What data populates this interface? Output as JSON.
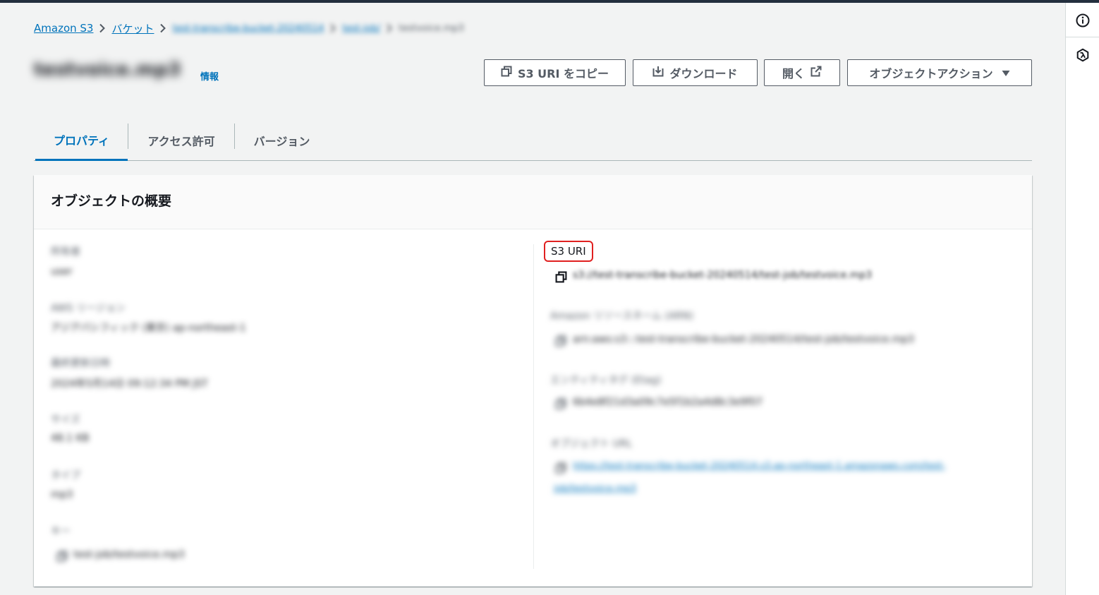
{
  "breadcrumb": {
    "items": [
      "Amazon S3",
      "バケット",
      "test-transcribe-bucket-20240514",
      "test-job/",
      "testvoice.mp3"
    ]
  },
  "header": {
    "object_name": "testvoice.mp3",
    "info_label": "情報"
  },
  "actions": {
    "copy_uri": "S3 URI をコピー",
    "download": "ダウンロード",
    "open": "開く",
    "object_actions": "オブジェクトアクション"
  },
  "tabs": [
    {
      "label": "プロパティ",
      "active": true
    },
    {
      "label": "アクセス許可",
      "active": false
    },
    {
      "label": "バージョン",
      "active": false
    }
  ],
  "panel": {
    "title": "オブジェクトの概要"
  },
  "left_fields": [
    {
      "label": "所有者",
      "value": "user"
    },
    {
      "label": "AWS リージョン",
      "value": "アジアパシフィック (東京) ap-northeast-1"
    },
    {
      "label": "最終更新日時",
      "value": "2024年5月14日 09:12:34 PM JST"
    },
    {
      "label": "サイズ",
      "value": "48.1 KB"
    },
    {
      "label": "タイプ",
      "value": "mp3"
    },
    {
      "label": "キー",
      "value": "test-job/testvoice.mp3"
    }
  ],
  "right_fields": {
    "s3uri_label": "S3 URI",
    "s3uri_value": "s3://test-transcribe-bucket-20240514/test-job/testvoice.mp3",
    "arn_label": "Amazon リソースネーム (ARN)",
    "arn_value": "arn:aws:s3:::test-transcribe-bucket-20240514/test-job/testvoice.mp3",
    "etag_label": "エンティティタグ (Etag)",
    "etag_value": "6b4e8f21d3a09c7e5f1b2a4d8c3e9f07",
    "url_label": "オブジェクト URL",
    "url_line1": "https://test-transcribe-bucket-20240514.s3.ap-northeast-1.amazonaws.com/test-",
    "url_line2": "job/testvoice.mp3"
  },
  "colors": {
    "link": "#0073bb",
    "text": "#16191f",
    "muted": "#545b64",
    "highlight": "#e02020",
    "background": "#f2f3f3"
  },
  "icons": [
    "info-icon",
    "lambda-icon",
    "chevron-right-icon",
    "copy-icon",
    "download-icon",
    "external-link-icon",
    "caret-down-icon"
  ]
}
